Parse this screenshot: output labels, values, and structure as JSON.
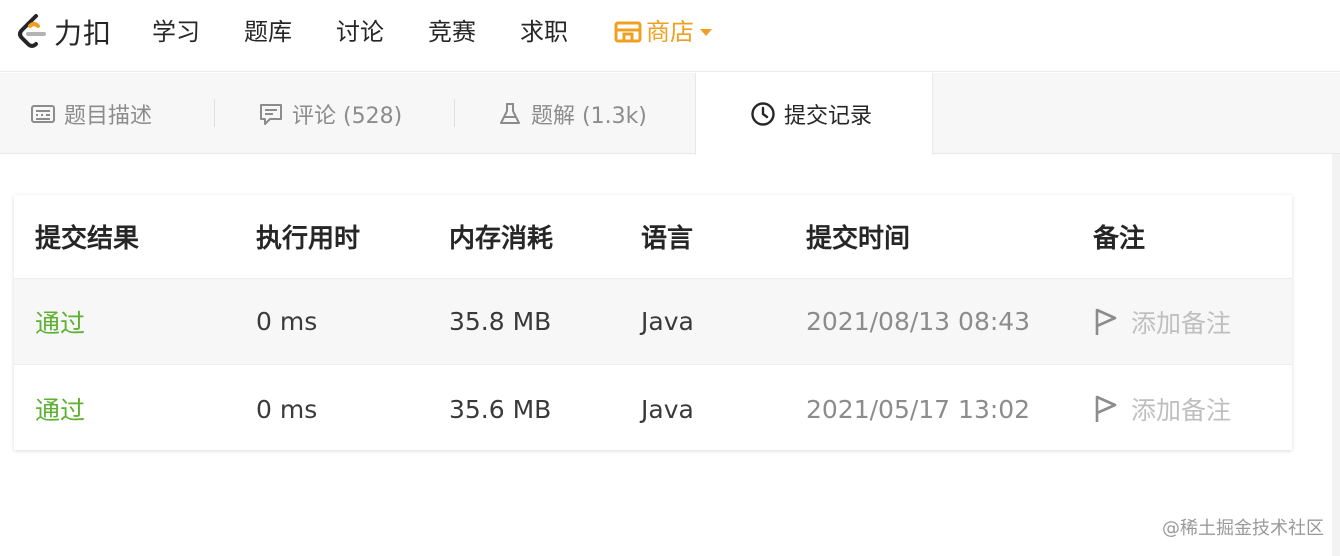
{
  "nav": {
    "logo_text": "力扣",
    "items": [
      "学习",
      "题库",
      "讨论",
      "竞赛",
      "求职"
    ],
    "store_label": "商店",
    "accent_color": "#f0a020"
  },
  "tabs": [
    {
      "label": "题目描述",
      "icon": "description-icon"
    },
    {
      "label": "评论 (528)",
      "icon": "comment-icon"
    },
    {
      "label": "题解 (1.3k)",
      "icon": "flask-icon"
    },
    {
      "label": "提交记录",
      "icon": "clock-icon",
      "active": true
    }
  ],
  "table": {
    "headers": [
      "提交结果",
      "执行用时",
      "内存消耗",
      "语言",
      "提交时间",
      "备注"
    ],
    "rows": [
      {
        "status": "通过",
        "runtime": "0 ms",
        "memory": "35.8 MB",
        "language": "Java",
        "submitted": "2021/08/13 08:43",
        "note_label": "添加备注"
      },
      {
        "status": "通过",
        "runtime": "0 ms",
        "memory": "35.6 MB",
        "language": "Java",
        "submitted": "2021/05/17 13:02",
        "note_label": "添加备注"
      }
    ],
    "status_color": "#5cb130"
  },
  "watermark": "@稀土掘金技术社区"
}
